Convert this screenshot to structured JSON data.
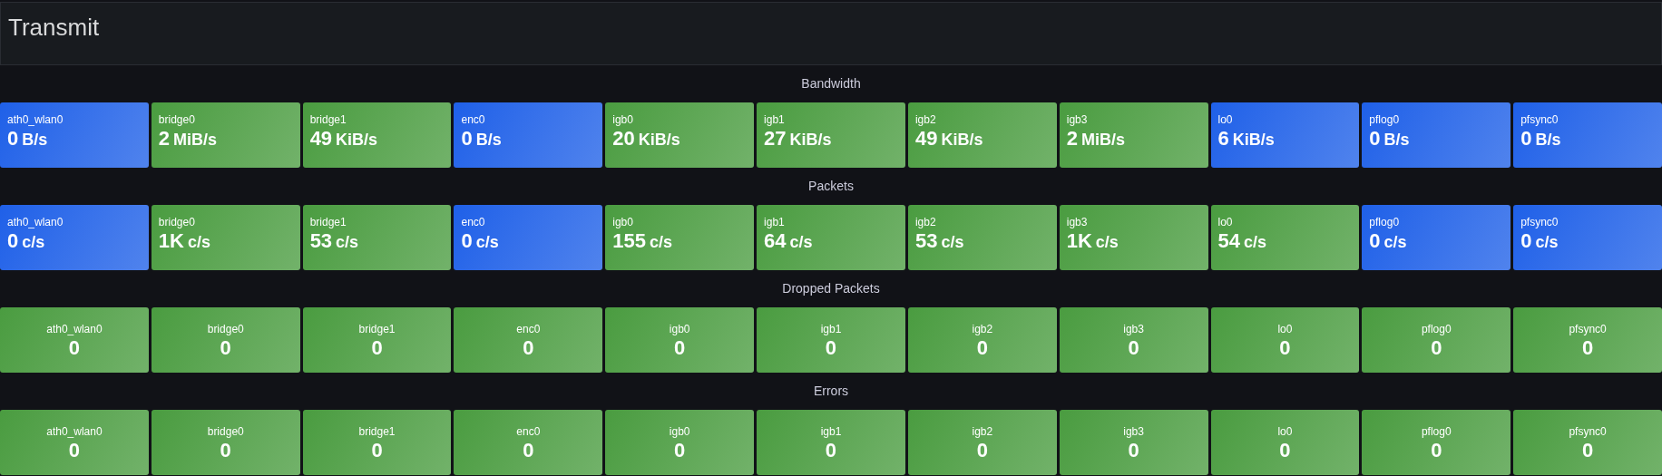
{
  "header": {
    "title": "Transmit"
  },
  "sections": [
    {
      "title": "Bandwidth",
      "kind": "corner",
      "tiles": [
        {
          "label": "ath0_wlan0",
          "value": "0",
          "unit": "B/s",
          "color": "#1f60e8"
        },
        {
          "label": "bridge0",
          "value": "2",
          "unit": "MiB/s",
          "color": "#4a9c40"
        },
        {
          "label": "bridge1",
          "value": "49",
          "unit": "KiB/s",
          "color": "#4a9c40"
        },
        {
          "label": "enc0",
          "value": "0",
          "unit": "B/s",
          "color": "#1f60e8"
        },
        {
          "label": "igb0",
          "value": "20",
          "unit": "KiB/s",
          "color": "#4a9c40"
        },
        {
          "label": "igb1",
          "value": "27",
          "unit": "KiB/s",
          "color": "#4a9c40"
        },
        {
          "label": "igb2",
          "value": "49",
          "unit": "KiB/s",
          "color": "#4a9c40"
        },
        {
          "label": "igb3",
          "value": "2",
          "unit": "MiB/s",
          "color": "#4a9c40"
        },
        {
          "label": "lo0",
          "value": "6",
          "unit": "KiB/s",
          "color": "#1f60e8"
        },
        {
          "label": "pflog0",
          "value": "0",
          "unit": "B/s",
          "color": "#1f60e8"
        },
        {
          "label": "pfsync0",
          "value": "0",
          "unit": "B/s",
          "color": "#1f60e8"
        }
      ]
    },
    {
      "title": "Packets",
      "kind": "corner",
      "tiles": [
        {
          "label": "ath0_wlan0",
          "value": "0",
          "unit": "c/s",
          "color": "#1f60e8"
        },
        {
          "label": "bridge0",
          "value": "1K",
          "unit": "c/s",
          "color": "#4a9c40"
        },
        {
          "label": "bridge1",
          "value": "53",
          "unit": "c/s",
          "color": "#4a9c40"
        },
        {
          "label": "enc0",
          "value": "0",
          "unit": "c/s",
          "color": "#1f60e8"
        },
        {
          "label": "igb0",
          "value": "155",
          "unit": "c/s",
          "color": "#4a9c40"
        },
        {
          "label": "igb1",
          "value": "64",
          "unit": "c/s",
          "color": "#4a9c40"
        },
        {
          "label": "igb2",
          "value": "53",
          "unit": "c/s",
          "color": "#4a9c40"
        },
        {
          "label": "igb3",
          "value": "1K",
          "unit": "c/s",
          "color": "#4a9c40"
        },
        {
          "label": "lo0",
          "value": "54",
          "unit": "c/s",
          "color": "#4a9c40"
        },
        {
          "label": "pflog0",
          "value": "0",
          "unit": "c/s",
          "color": "#1f60e8"
        },
        {
          "label": "pfsync0",
          "value": "0",
          "unit": "c/s",
          "color": "#1f60e8"
        }
      ]
    },
    {
      "title": "Dropped Packets",
      "kind": "centered",
      "tiles": [
        {
          "label": "ath0_wlan0",
          "value": "0",
          "color": "#4a9c40"
        },
        {
          "label": "bridge0",
          "value": "0",
          "color": "#4a9c40"
        },
        {
          "label": "bridge1",
          "value": "0",
          "color": "#4a9c40"
        },
        {
          "label": "enc0",
          "value": "0",
          "color": "#4a9c40"
        },
        {
          "label": "igb0",
          "value": "0",
          "color": "#4a9c40"
        },
        {
          "label": "igb1",
          "value": "0",
          "color": "#4a9c40"
        },
        {
          "label": "igb2",
          "value": "0",
          "color": "#4a9c40"
        },
        {
          "label": "igb3",
          "value": "0",
          "color": "#4a9c40"
        },
        {
          "label": "lo0",
          "value": "0",
          "color": "#4a9c40"
        },
        {
          "label": "pflog0",
          "value": "0",
          "color": "#4a9c40"
        },
        {
          "label": "pfsync0",
          "value": "0",
          "color": "#4a9c40"
        }
      ]
    },
    {
      "title": "Errors",
      "kind": "centered",
      "tiles": [
        {
          "label": "ath0_wlan0",
          "value": "0",
          "color": "#4a9c40"
        },
        {
          "label": "bridge0",
          "value": "0",
          "color": "#4a9c40"
        },
        {
          "label": "bridge1",
          "value": "0",
          "color": "#4a9c40"
        },
        {
          "label": "enc0",
          "value": "0",
          "color": "#4a9c40"
        },
        {
          "label": "igb0",
          "value": "0",
          "color": "#4a9c40"
        },
        {
          "label": "igb1",
          "value": "0",
          "color": "#4a9c40"
        },
        {
          "label": "igb2",
          "value": "0",
          "color": "#4a9c40"
        },
        {
          "label": "igb3",
          "value": "0",
          "color": "#4a9c40"
        },
        {
          "label": "lo0",
          "value": "0",
          "color": "#4a9c40"
        },
        {
          "label": "pflog0",
          "value": "0",
          "color": "#4a9c40"
        },
        {
          "label": "pfsync0",
          "value": "0",
          "color": "#4a9c40"
        }
      ]
    }
  ]
}
